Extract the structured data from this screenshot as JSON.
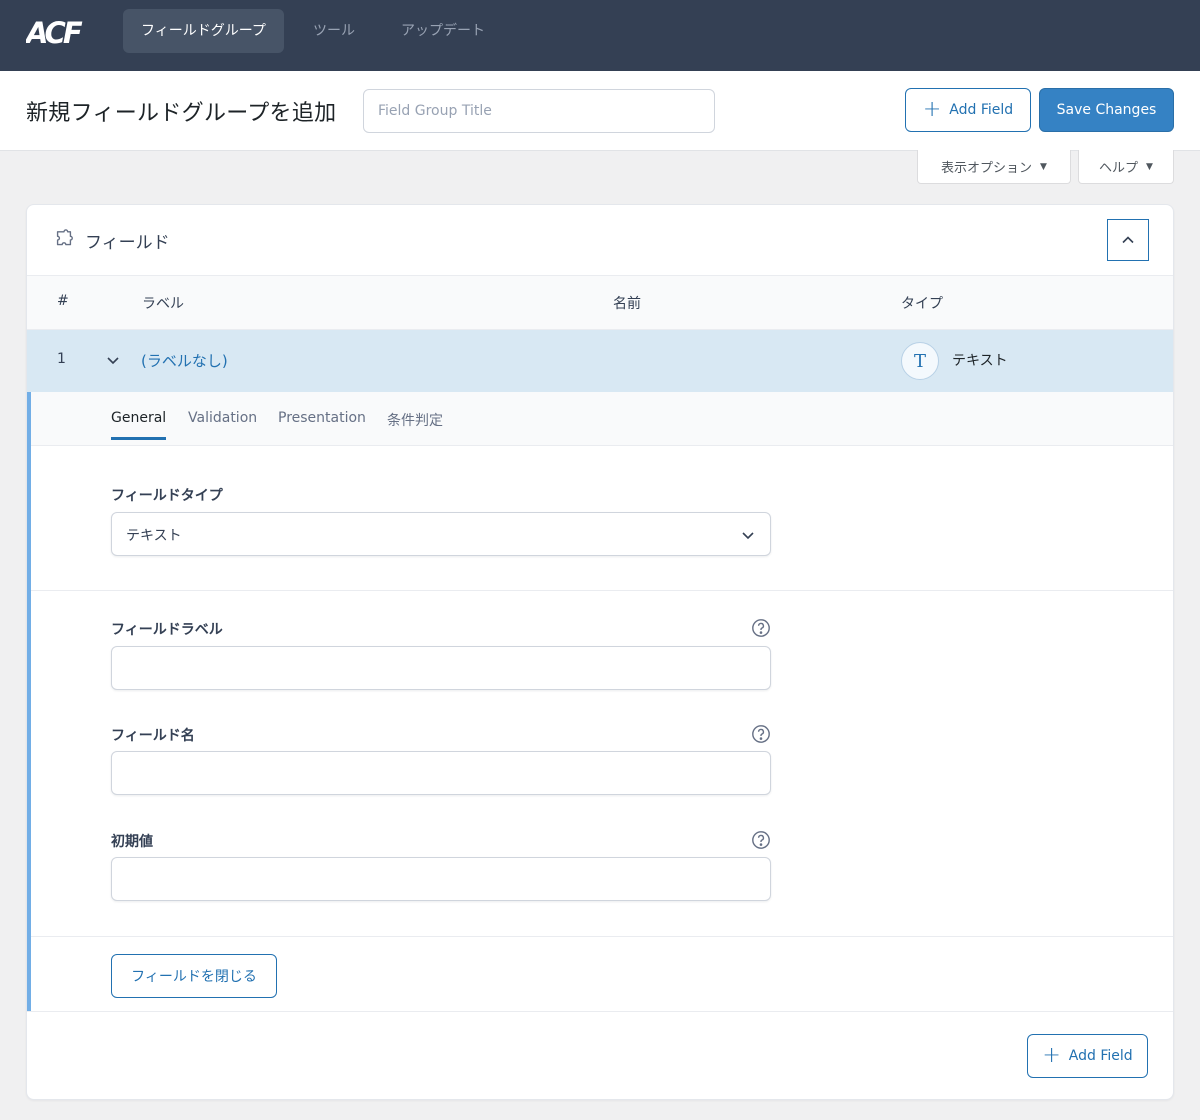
{
  "nav": {
    "logo": "ACF",
    "tabs": [
      {
        "label": "フィールドグループ",
        "active": true
      },
      {
        "label": "ツール",
        "active": false
      },
      {
        "label": "アップデート",
        "active": false
      }
    ]
  },
  "header": {
    "title": "新規フィールドグループを追加",
    "title_placeholder": "Field Group Title",
    "add_field_label": "Add Field",
    "save_label": "Save Changes"
  },
  "screen_options": {
    "display_label": "表示オプション",
    "help_label": "ヘルプ"
  },
  "panel": {
    "title": "フィールド",
    "columns": {
      "num": "#",
      "label": "ラベル",
      "name": "名前",
      "type": "タイプ"
    },
    "field_row": {
      "num": "1",
      "label": "(ラベルなし)",
      "type_icon_glyph": "T",
      "type": "テキスト"
    },
    "tabs": [
      {
        "label": "General",
        "active": true
      },
      {
        "label": "Validation",
        "active": false
      },
      {
        "label": "Presentation",
        "active": false
      },
      {
        "label": "条件判定",
        "active": false
      }
    ],
    "settings": {
      "field_type_label": "フィールドタイプ",
      "field_type_value": "テキスト",
      "field_label_label": "フィールドラベル",
      "field_name_label": "フィールド名",
      "default_value_label": "初期値"
    },
    "close_label": "フィールドを閉じる",
    "footer_add_label": "Add Field"
  },
  "colors": {
    "nav_bg": "#344054",
    "accent": "#2271b1",
    "primary_button": "#3582c4",
    "row_highlight": "#d8e8f3"
  }
}
